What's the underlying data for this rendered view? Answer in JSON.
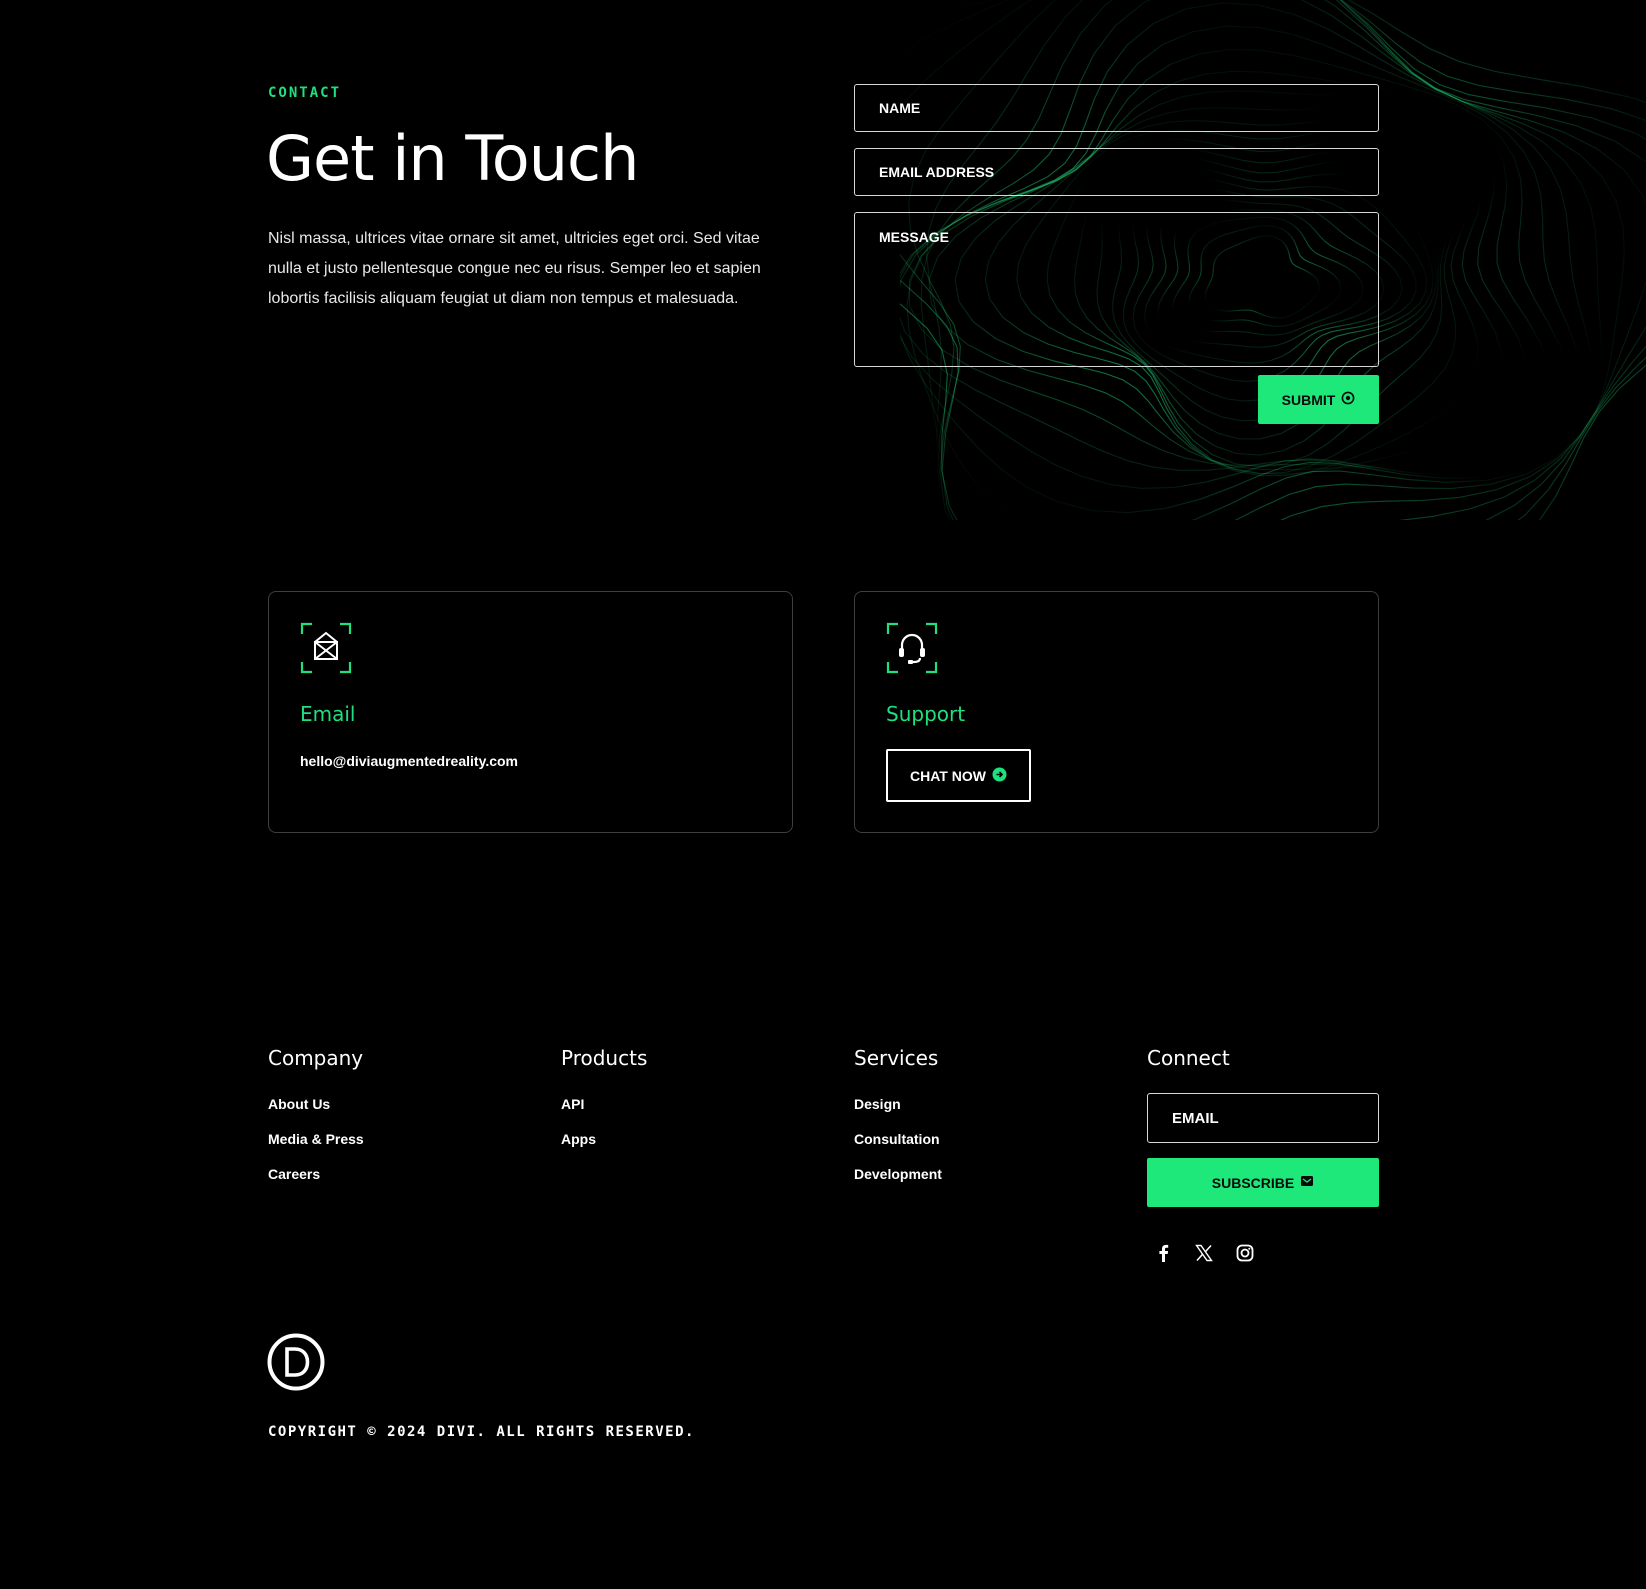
{
  "colors": {
    "background": "#000000",
    "accent": "#1fe87a",
    "text": "#ffffff",
    "card_border": "#3e3e3e"
  },
  "contact": {
    "eyebrow": "CONTACT",
    "heading": "Get in Touch",
    "intro": "Nisl massa, ultrices vitae ornare sit amet, ultricies eget orci. Sed vitae nulla et justo pellentesque congue nec eu risus. Semper leo et sapien lobortis facilisis aliquam feugiat ut diam non tempus et malesuada."
  },
  "form": {
    "name_placeholder": "NAME",
    "email_placeholder": "EMAIL ADDRESS",
    "message_placeholder": "MESSAGE",
    "submit_label": "SUBMIT",
    "submit_icon": "circle-dot-icon"
  },
  "cards": {
    "email": {
      "icon": "envelope-icon",
      "title": "Email",
      "value": "hello@diviaugmentedreality.com"
    },
    "support": {
      "icon": "headset-icon",
      "title": "Support",
      "button_label": "CHAT NOW",
      "button_icon": "arrow-circle-right-icon"
    }
  },
  "footer": {
    "company": {
      "title": "Company",
      "links": [
        "About Us",
        "Media & Press",
        "Careers"
      ]
    },
    "products": {
      "title": "Products",
      "links": [
        "API",
        "Apps"
      ]
    },
    "services": {
      "title": "Services",
      "links": [
        "Design",
        "Consultation",
        "Development"
      ]
    },
    "connect": {
      "title": "Connect",
      "email_placeholder": "EMAIL",
      "subscribe_label": "SUBSCRIBE",
      "subscribe_icon": "envelope-open-icon",
      "social": [
        "facebook-icon",
        "x-icon",
        "instagram-icon"
      ]
    },
    "logo": "divi-logo",
    "copyright": "COPYRIGHT © 2024 DIVI. ALL RIGHTS RESERVED."
  }
}
